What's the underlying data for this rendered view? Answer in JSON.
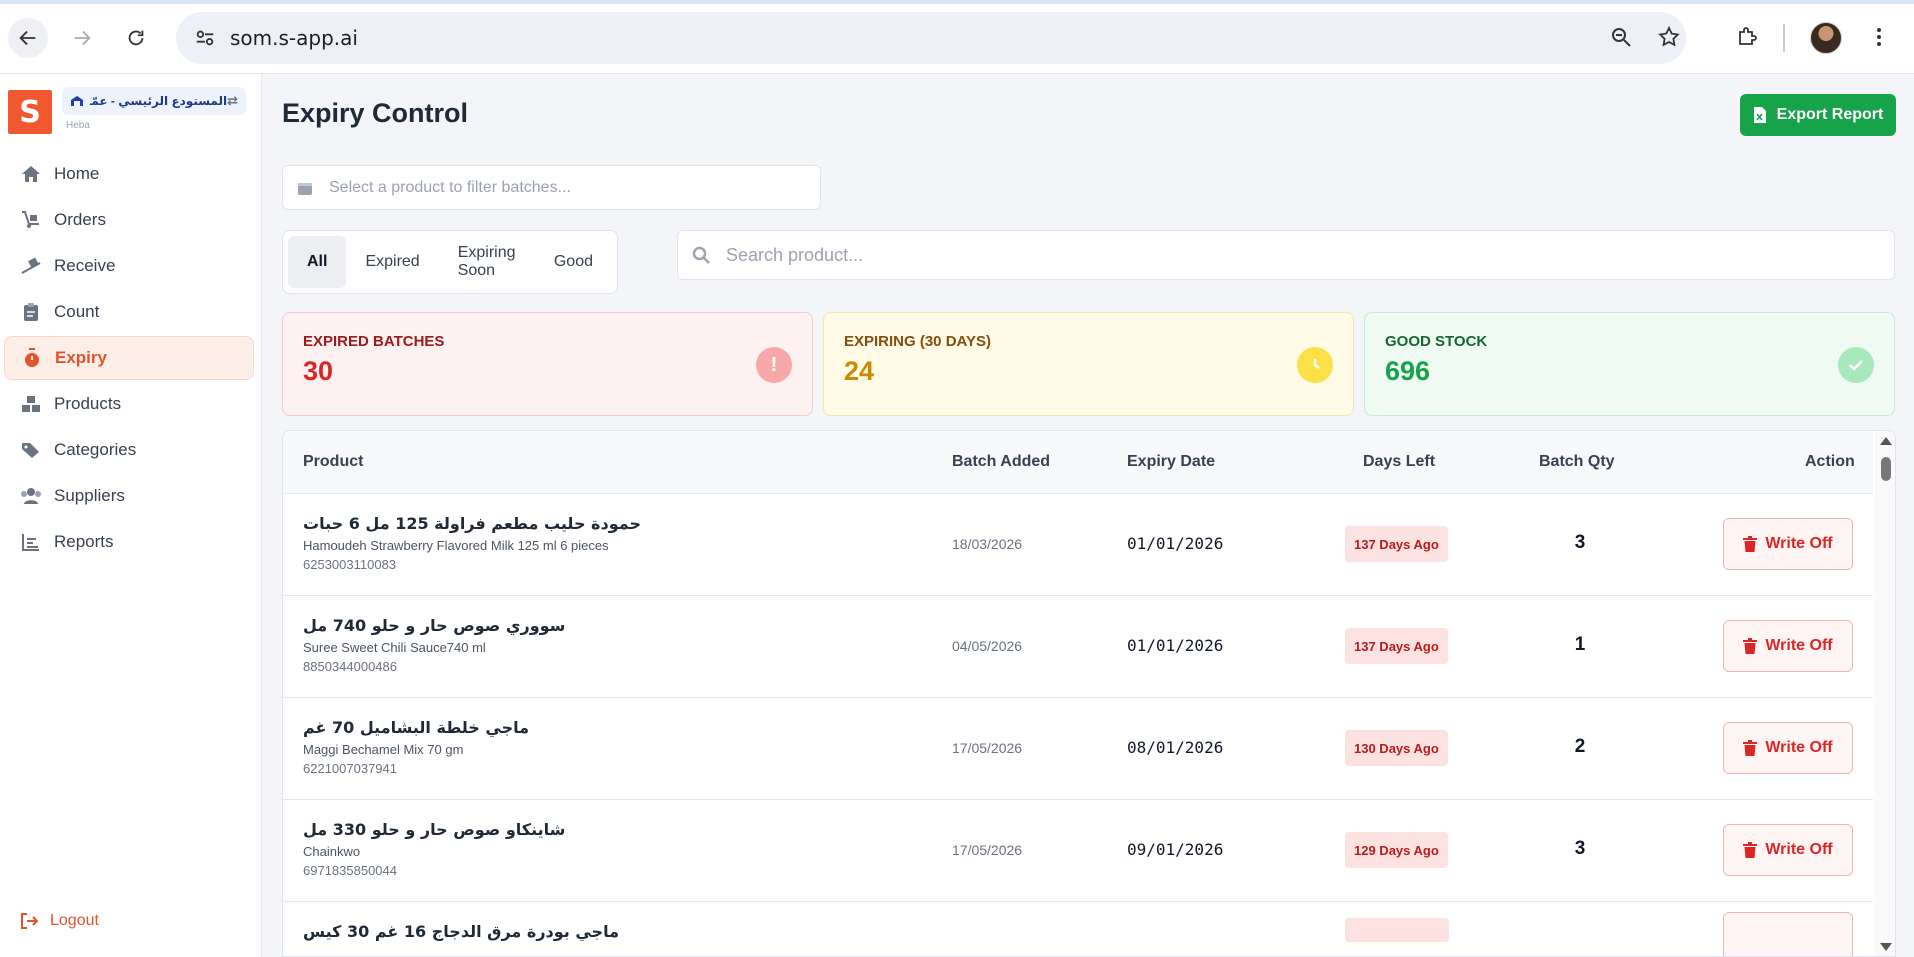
{
  "browser": {
    "url": "som.s-app.ai"
  },
  "sidebar": {
    "logo_letter": "S",
    "store_name": "المستودع الرئيسي - عمّان",
    "store_user": "Heba",
    "items": [
      {
        "label": "Home",
        "icon": "home-icon"
      },
      {
        "label": "Orders",
        "icon": "dolly-icon"
      },
      {
        "label": "Receive",
        "icon": "truck-ramp-icon"
      },
      {
        "label": "Count",
        "icon": "clipboard-icon"
      },
      {
        "label": "Expiry",
        "icon": "stopwatch-icon"
      },
      {
        "label": "Products",
        "icon": "boxes-icon"
      },
      {
        "label": "Categories",
        "icon": "tags-icon"
      },
      {
        "label": "Suppliers",
        "icon": "users-icon"
      },
      {
        "label": "Reports",
        "icon": "chart-bar-icon"
      }
    ],
    "active": "Expiry",
    "logout": "Logout"
  },
  "header": {
    "title": "Expiry Control",
    "export_label": "Export Report"
  },
  "filters": {
    "product_placeholder": "Select a product to filter batches...",
    "tabs": [
      "All",
      "Expired",
      "Expiring Soon",
      "Good"
    ],
    "active_tab": "All",
    "search_placeholder": "Search product..."
  },
  "stats": {
    "expired": {
      "label": "EXPIRED BATCHES",
      "value": "30"
    },
    "expiring": {
      "label": "EXPIRING (30 DAYS)",
      "value": "24"
    },
    "good": {
      "label": "GOOD STOCK",
      "value": "696"
    }
  },
  "table": {
    "columns": [
      "Product",
      "Batch Added",
      "Expiry Date",
      "Days Left",
      "Batch Qty",
      "Action"
    ],
    "action_label": "Write Off",
    "rows": [
      {
        "name_ar": "حمودة حليب مطعم فراولة 125 مل 6 حبات",
        "name_en": "Hamoudeh Strawberry Flavored Milk 125 ml 6 pieces",
        "code": "6253003110083",
        "added": "18/03/2026",
        "expiry": "01/01/2026",
        "days": "137 Days Ago",
        "qty": "3"
      },
      {
        "name_ar": "سووري صوص حار و حلو 740 مل",
        "name_en": "Suree Sweet Chili Sauce740 ml",
        "code": "8850344000486",
        "added": "04/05/2026",
        "expiry": "01/01/2026",
        "days": "137 Days Ago",
        "qty": "1"
      },
      {
        "name_ar": "ماجي خلطة البشاميل 70 غم",
        "name_en": "Maggi Bechamel Mix 70 gm",
        "code": "6221007037941",
        "added": "17/05/2026",
        "expiry": "08/01/2026",
        "days": "130 Days Ago",
        "qty": "2"
      },
      {
        "name_ar": "شاينكاو صوص حار و حلو 330 مل",
        "name_en": "Chainkwo",
        "code": "6971835850044",
        "added": "17/05/2026",
        "expiry": "09/01/2026",
        "days": "129 Days Ago",
        "qty": "3"
      },
      {
        "name_ar": "ماجي بودرة مرق الدجاج 16 غم 30 كيس",
        "name_en": "",
        "code": "",
        "added": "",
        "expiry": "",
        "days": "",
        "qty": ""
      }
    ]
  }
}
